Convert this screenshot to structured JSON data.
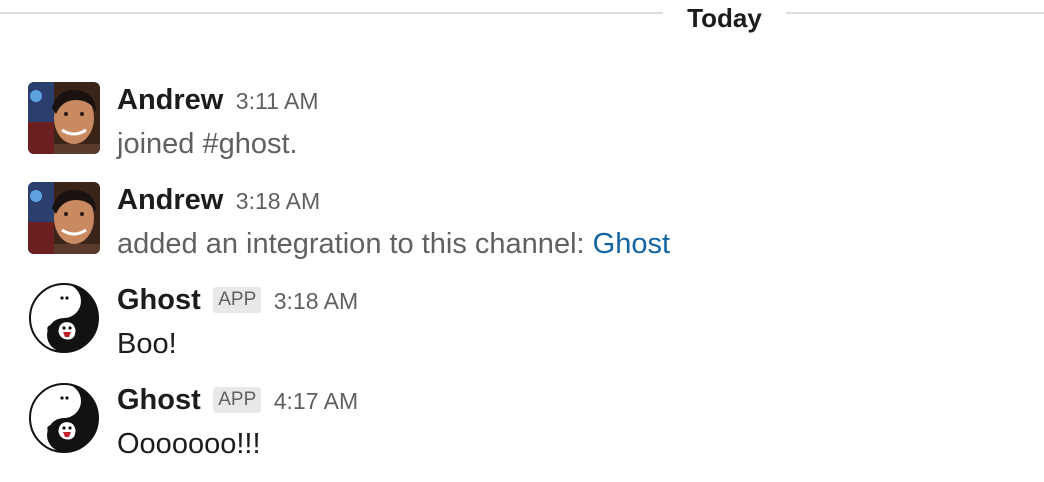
{
  "divider": {
    "label": "Today"
  },
  "messages": [
    {
      "sender": "Andrew",
      "time": "3:11 AM",
      "text": "joined #ghost.",
      "avatar_icon": "user-photo-andrew"
    },
    {
      "sender": "Andrew",
      "time": "3:18 AM",
      "text": "added an integration to this channel: ",
      "link": "Ghost",
      "avatar_icon": "user-photo-andrew"
    },
    {
      "sender": "Ghost",
      "badge": "APP",
      "time": "3:18 AM",
      "text": "Boo!",
      "avatar_icon": "ghost-yinyang-icon"
    },
    {
      "sender": "Ghost",
      "badge": "APP",
      "time": "4:17 AM",
      "text": "Ooooooo!!!",
      "avatar_icon": "ghost-yinyang-icon"
    }
  ],
  "colors": {
    "link": "#1264a3",
    "meta": "#616061",
    "text": "#1d1c1d",
    "divider_line": "#dddddd",
    "badge_bg": "#e8e8e8"
  }
}
